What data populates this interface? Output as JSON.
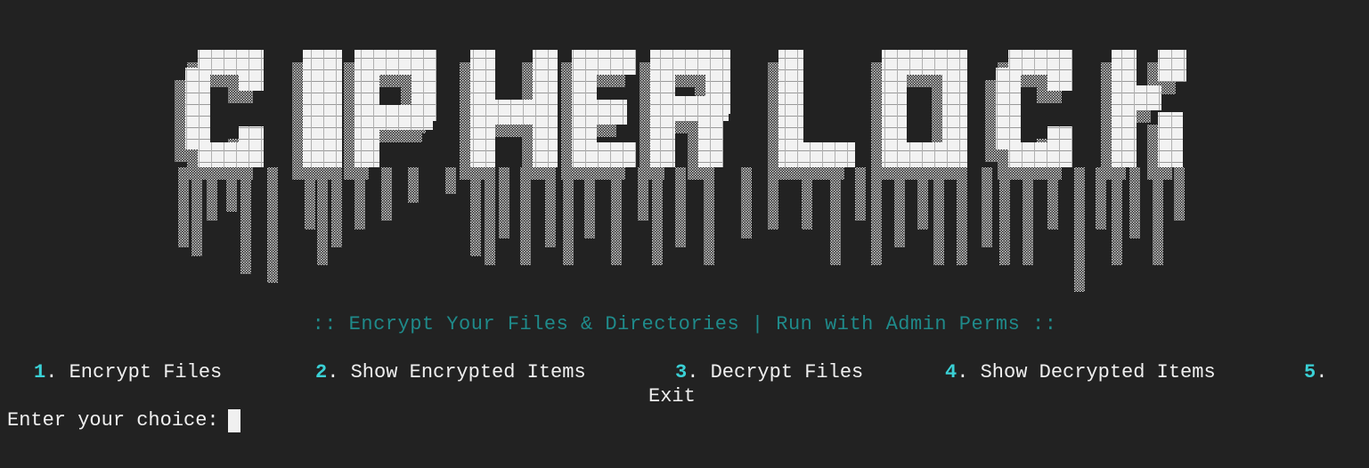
{
  "banner": {
    "logo_text": "CIPHERLOCK",
    "tagline": ":: Encrypt Your Files & Directories | Run with Admin Perms ::"
  },
  "menu": {
    "items": [
      {
        "number": "1",
        "label": "Encrypt Files"
      },
      {
        "number": "2",
        "label": "Show Encrypted Items"
      },
      {
        "number": "3",
        "label": "Decrypt Files"
      },
      {
        "number": "4",
        "label": "Show Decrypted Items"
      },
      {
        "number": "5",
        "label": "Exit"
      }
    ]
  },
  "prompt": {
    "text": "Enter your choice:",
    "value": ""
  },
  "colors": {
    "background": "#222222",
    "tagline": "#1f8a8a",
    "menu_number": "#3ad1d6",
    "text": "#f0f0f0"
  }
}
